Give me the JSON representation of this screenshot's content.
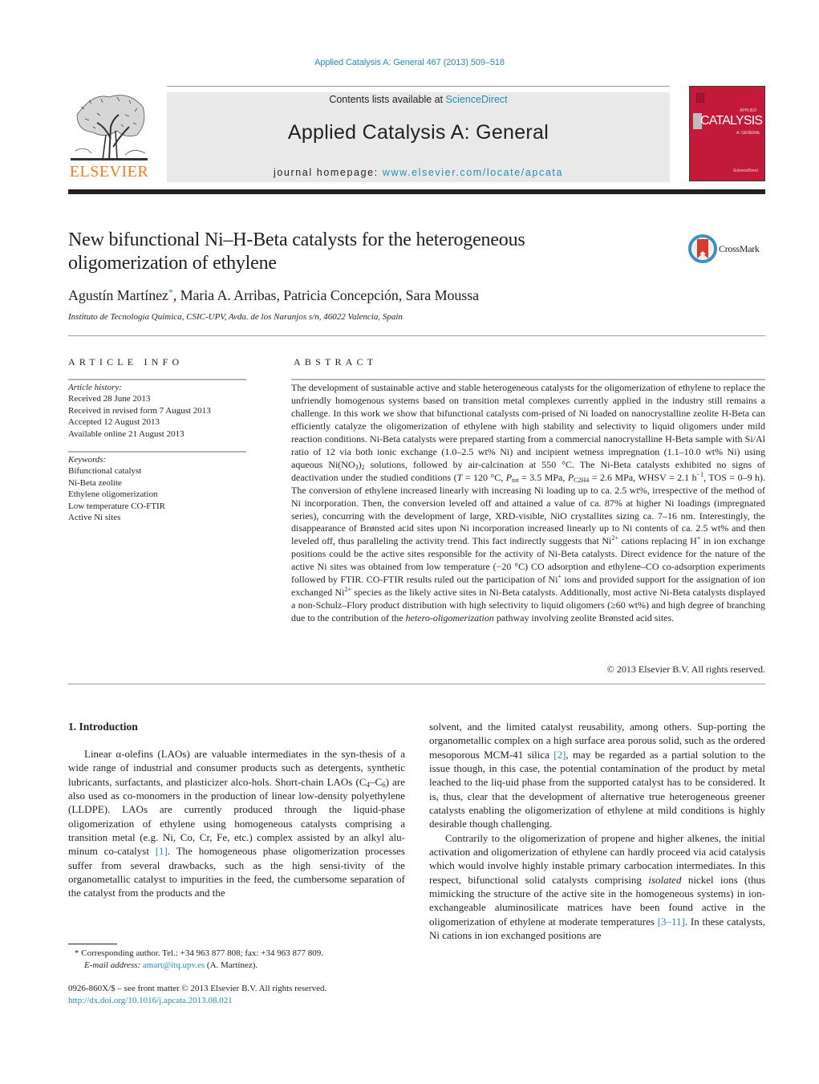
{
  "header": {
    "citation": "Applied Catalysis A: General 467 (2013) 509–518",
    "contents_prefix": "Contents lists available at ",
    "contents_link": "ScienceDirect",
    "journal_title": "Applied Catalysis A: General",
    "homepage_prefix": "journal homepage: ",
    "homepage_link": "www.elsevier.com/locate/apcata",
    "publisher_logo_text": "ELSEVIER",
    "cover_word": "CATALYSIS",
    "cover_small_top": "APPLIED",
    "cover_small_bottom": "A: GENERAL",
    "cover_footer": "ScienceDirect",
    "brand_orange": "#f47c20",
    "cover_red": "#c41a3a",
    "link_blue": "#2a8ab8"
  },
  "article": {
    "title": "New bifunctional Ni–H-Beta catalysts for the heterogeneous oligomerization of ethylene",
    "crossmark_label": "CrossMark",
    "authors_first": "Agustín Martínez",
    "author_mark": "*",
    "authors_rest": ", Maria A. Arribas, Patricia Concepción, Sara Moussa",
    "affiliation": "Instituto de Tecnología Química, CSIC-UPV, Avda. de los Naranjos s/n, 46022 Valencia, Spain"
  },
  "article_info": {
    "heading": "ARTICLE INFO",
    "history_label": "Article history:",
    "history": [
      "Received 28 June 2013",
      "Received in revised form 7 August 2013",
      "Accepted 12 August 2013",
      "Available online 21 August 2013"
    ],
    "keywords_label": "Keywords:",
    "keywords": [
      "Bifunctional catalyst",
      "Ni-Beta zeolite",
      "Ethylene oligomerization",
      "Low temperature CO-FTIR",
      "Active Ni sites"
    ]
  },
  "abstract": {
    "heading": "ABSTRACT",
    "p1": "The development of sustainable active and stable heterogeneous catalysts for the oligomerization of ethylene to replace the unfriendly homogenous systems based on transition metal complexes currently applied in the industry still remains a challenge. In this work we show that bifunctional catalysts com-prised of Ni loaded on nanocrystalline zeolite H-Beta can efficiently catalyze the oligomerization of ethylene with high stability and selectivity to liquid oligomers under mild reaction conditions. Ni-Beta catalysts were prepared starting from a commercial nanocrystalline H-Beta sample with Si/Al ratio of 12 via both ionic exchange (1.0–2.5 wt% Ni) and incipient wetness impregnation (1.1–10.0 wt% Ni) using aqueous Ni(NO",
    "p1_sub": "3",
    "p1b": ")",
    "p1b_sub": "2",
    "p2": " solutions, followed by air-calcination at 550 °C. The Ni-Beta catalysts exhibited no signs of deactivation under the studied conditions (",
    "T_sym": "T",
    "p3": " = 120 °C, ",
    "P_sym": "P",
    "P_tot_sub": "tot",
    "p4": " = 3.5 MPa, ",
    "P_C2H4_sub": "C2H4",
    "p5": " = 2.6 MPa, WHSV = 2.1 h",
    "p5_sup": "−1",
    "p6": ", TOS = 0–9 h). The conversion of ethylene increased linearly with increasing Ni loading up to ca. 2.5 wt%, irrespective of the method of Ni incorporation. Then, the conversion leveled off and attained a value of ca. 87% at higher Ni loadings (impregnated series), concurring with the development of large, XRD-visible, NiO crystallites sizing ca. 7–16 nm. Interestingly, the disappearance of Brønsted acid sites upon Ni incorporation increased linearly up to Ni contents of ca. 2.5 wt% and then leveled off, thus paralleling the activity trend. This fact indirectly suggests that Ni",
    "p6_sup": "2+",
    "p7": " cations replacing H",
    "p7_sup": "+",
    "p8": " in ion exchange positions could be the active sites responsible for the activity of Ni-Beta catalysts. Direct evidence for the nature of the active Ni sites was obtained from low temperature (−20 °C) CO adsorption and ethylene–CO co-adsorption experiments followed by FTIR. CO-FTIR results ruled out the participation of Ni",
    "p8_sup": "+",
    "p9": " ions and provided support for the assignation of ion exchanged Ni",
    "p9_sup": "2+",
    "p10": " species as the likely active sites in Ni-Beta catalysts. Additionally, most active Ni-Beta catalysts displayed a non-Schulz–Flory product distribution with high selectivity to liquid oligomers (≥60 wt%) and high degree of branching due to the contribution of the ",
    "p10_ital": "hetero-oligomerization",
    "p11": " pathway involving zeolite Brønsted acid sites.",
    "copyright": "© 2013 Elsevier B.V. All rights reserved."
  },
  "body": {
    "section_heading": "1.  Introduction",
    "left_a": "Linear α-olefins (LAOs) are valuable intermediates in the syn-thesis of a wide range of industrial and consumer products such as detergents, synthetic lubricants, surfactants, and plasticizer alco-hols. Short-chain LAOs (C",
    "left_sub1": "4",
    "left_b": "–C",
    "left_sub2": "6",
    "left_c": ") are also used as co-monomers in the production of linear low-density polyethylene (LLDPE). LAOs are currently produced through the liquid-phase oligomerization of ethylene using homogeneous catalysts comprising a transition metal (e.g. Ni, Co, Cr, Fe, etc.) complex assisted by an alkyl alu-minum co-catalyst ",
    "ref1": "[1]",
    "left_d": ". The homogeneous phase oligomerization processes suffer from several drawbacks, such as the high sensi-tivity of the organometallic catalyst to impurities in the feed, the cumbersome separation of the catalyst from the products and the",
    "right_a": "solvent, and the limited catalyst reusability, among others. Sup-porting the organometallic complex on a high surface area porous solid, such as the ordered mesoporous MCM-41 silica ",
    "ref2": "[2]",
    "right_b": ", may be regarded as a partial solution to the issue though, in this case, the potential contamination of the product by metal leached to the liq-uid phase from the supported catalyst has to be considered. It is, thus, clear that the development of alternative true heterogeneous greener catalysts enabling the oligomerization of ethylene at mild conditions is highly desirable though challenging.",
    "right_c": "Contrarily to the oligomerization of propene and higher alkenes, the initial activation and oligomerization of ethylene can hardly proceed via acid catalysis which would involve highly instable primary carbocation intermediates. In this respect, bifunctional solid catalysts comprising ",
    "right_ital": "isolated",
    "right_d": " nickel ions (thus mimicking the structure of the active site in the homogeneous systems) in ion-exchangeable aluminosilicate matrices have been found active in the oligomerization of ethylene at moderate temperatures ",
    "ref3": "[3–11]",
    "right_e": ". In these catalysts, Ni cations in ion exchanged positions are"
  },
  "footnotes": {
    "star": "*",
    "corresponding": " Corresponding author. Tel.: +34 963 877 808; fax: +34 963 877 809.",
    "email_label": "E-mail address: ",
    "email": "amart@itq.upv.es",
    "email_suffix": " (A. Martínez).",
    "front_matter": "0926-860X/$ – see front matter © 2013 Elsevier B.V. All rights reserved.",
    "doi": "http://dx.doi.org/10.1016/j.apcata.2013.08.021"
  }
}
